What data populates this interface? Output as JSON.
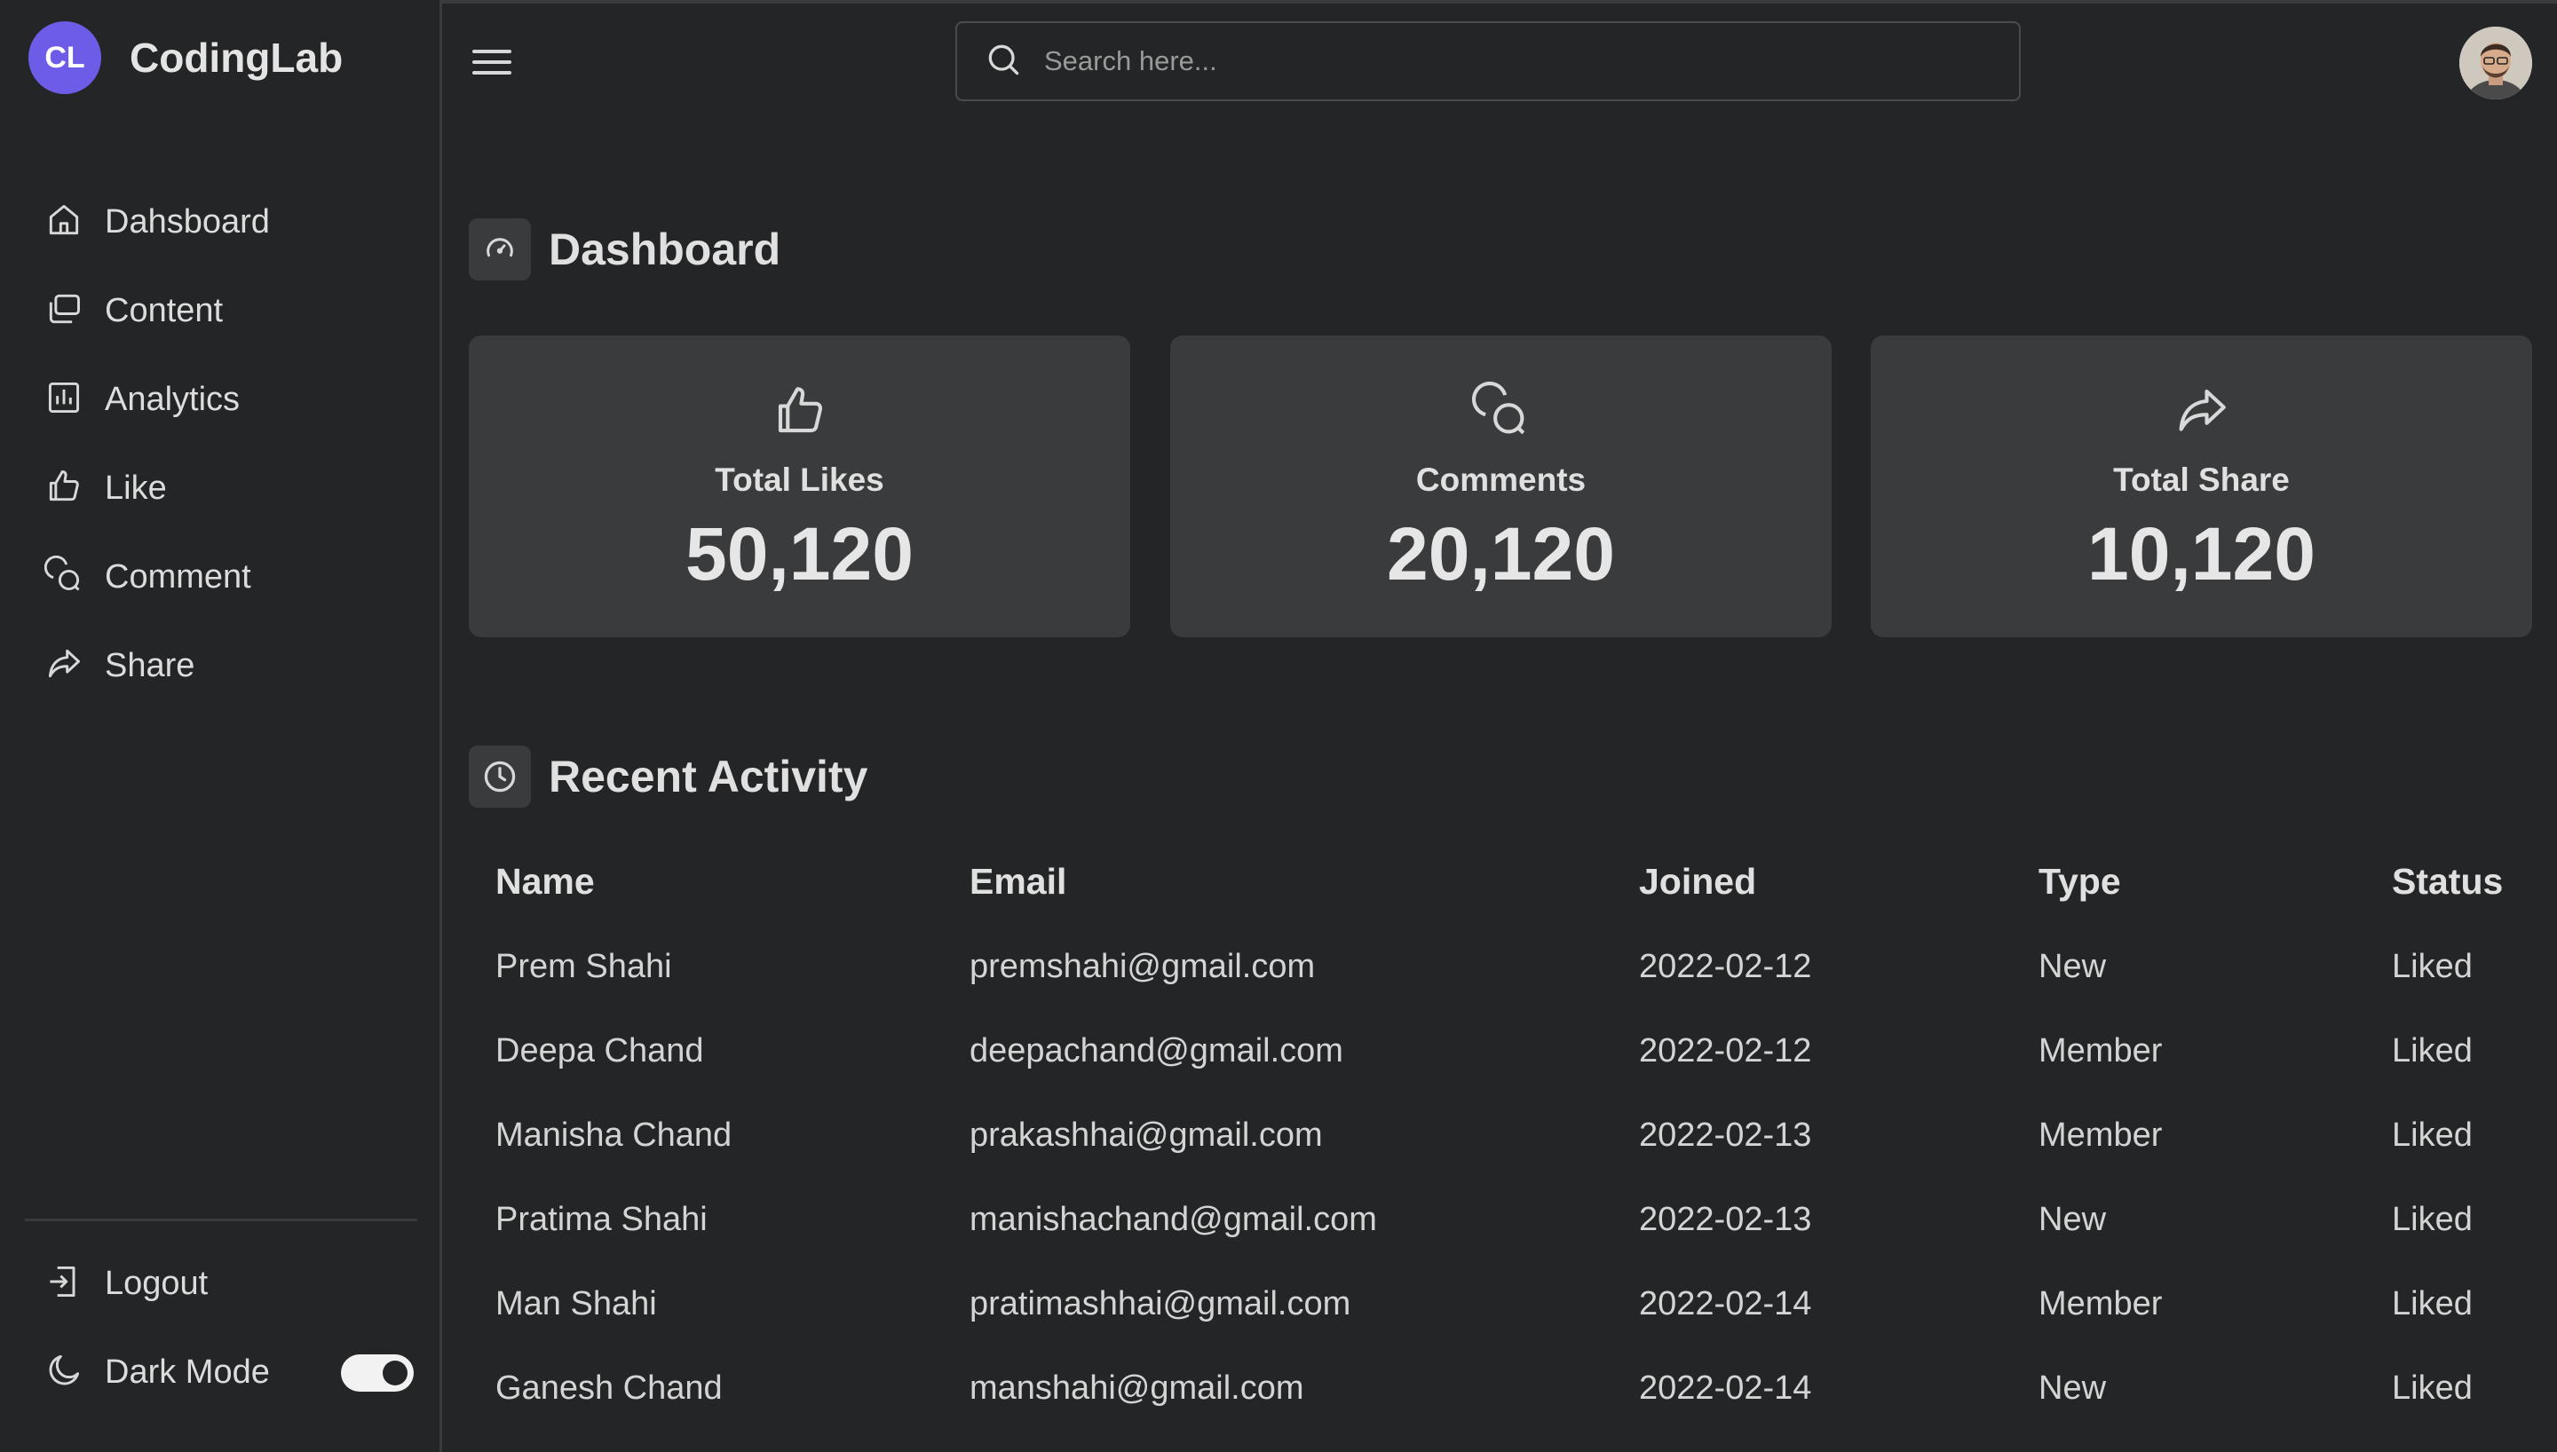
{
  "logo": {
    "initials": "CL",
    "name": "CodingLab"
  },
  "sidebar": {
    "items": [
      {
        "label": "Dahsboard",
        "icon": "home-icon"
      },
      {
        "label": "Content",
        "icon": "files-icon"
      },
      {
        "label": "Analytics",
        "icon": "chart-icon"
      },
      {
        "label": "Like",
        "icon": "thumbs-up-icon"
      },
      {
        "label": "Comment",
        "icon": "comments-icon"
      },
      {
        "label": "Share",
        "icon": "share-icon"
      }
    ],
    "logout_label": "Logout",
    "dark_mode_label": "Dark Mode",
    "dark_mode_on": true
  },
  "search": {
    "placeholder": "Search here..."
  },
  "dashboard": {
    "title": "Dashboard",
    "stats": [
      {
        "label": "Total Likes",
        "value": "50,120",
        "icon": "thumbs-up-icon"
      },
      {
        "label": "Comments",
        "value": "20,120",
        "icon": "comments-icon"
      },
      {
        "label": "Total Share",
        "value": "10,120",
        "icon": "share-icon"
      }
    ]
  },
  "activity": {
    "title": "Recent Activity",
    "columns": [
      "Name",
      "Email",
      "Joined",
      "Type",
      "Status"
    ],
    "rows": [
      [
        "Prem Shahi",
        "premshahi@gmail.com",
        "2022-02-12",
        "New",
        "Liked"
      ],
      [
        "Deepa Chand",
        "deepachand@gmail.com",
        "2022-02-12",
        "Member",
        "Liked"
      ],
      [
        "Manisha Chand",
        "prakashhai@gmail.com",
        "2022-02-13",
        "Member",
        "Liked"
      ],
      [
        "Pratima Shahi",
        "manishachand@gmail.com",
        "2022-02-13",
        "New",
        "Liked"
      ],
      [
        "Man Shahi",
        "pratimashhai@gmail.com",
        "2022-02-14",
        "Member",
        "Liked"
      ],
      [
        "Ganesh Chand",
        "manshahi@gmail.com",
        "2022-02-14",
        "New",
        "Liked"
      ]
    ]
  },
  "colors": {
    "background": "#242526",
    "card": "#3a3b3c",
    "accent": "#6c5ce7",
    "text": "#cccccc"
  }
}
